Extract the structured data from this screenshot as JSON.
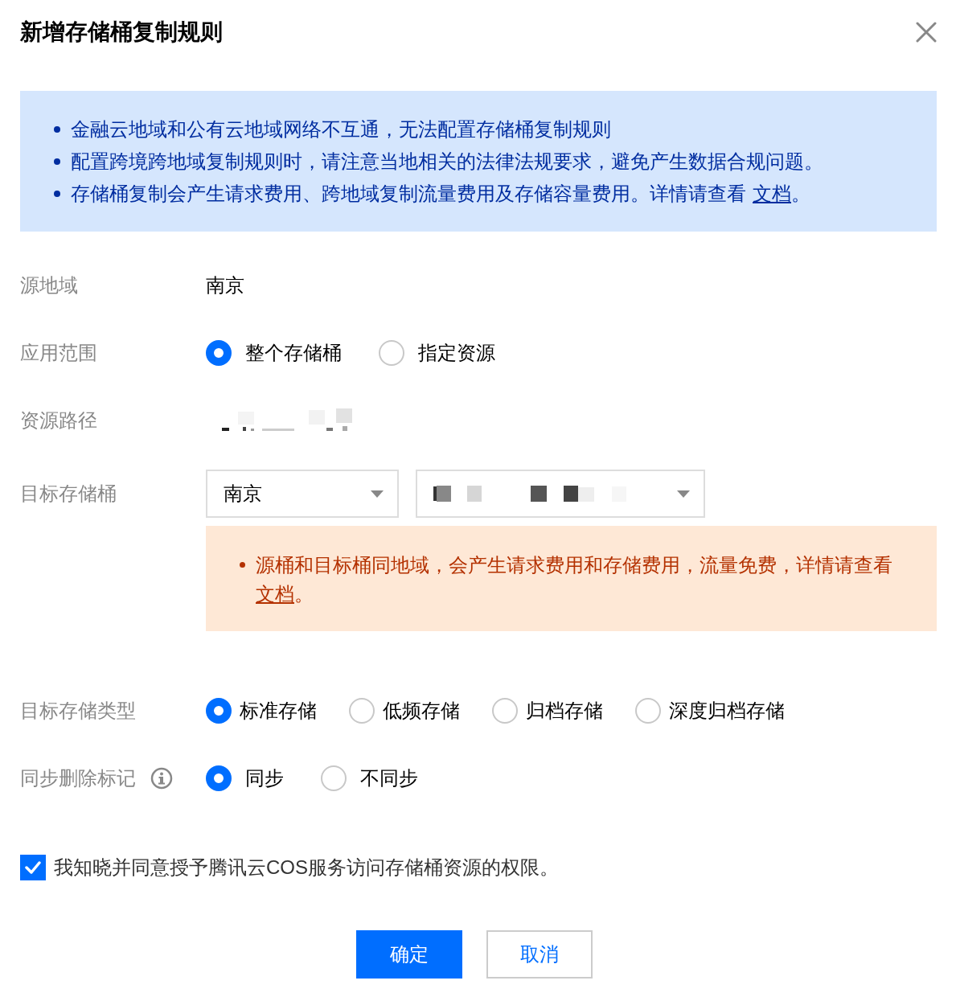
{
  "dialog": {
    "title": "新增存储桶复制规则"
  },
  "notice": {
    "items": [
      {
        "text": "金融云地域和公有云地域网络不互通，无法配置存储桶复制规则"
      },
      {
        "text": "配置跨境跨地域复制规则时，请注意当地相关的法律法规要求，避免产生数据合规问题。"
      },
      {
        "text": "存储桶复制会产生请求费用、跨地域复制流量费用及存储容量费用。详情请查看",
        "link": "文档",
        "after": "。"
      }
    ]
  },
  "fields": [
    {
      "kind": "text",
      "label": "源地域",
      "value": "南京"
    },
    {
      "kind": "radio",
      "label": "应用范围",
      "options": [
        {
          "label": "整个存储桶",
          "selected": true
        },
        {
          "label": "指定资源",
          "selected": false
        }
      ]
    },
    {
      "kind": "redacted",
      "label": "资源路径"
    },
    {
      "kind": "select",
      "label": "目标存储桶",
      "selects": [
        {
          "kind": "value",
          "value": "南京"
        },
        {
          "kind": "redacted"
        }
      ],
      "warning": {
        "text": "源桶和目标桶同地域，会产生请求费用和存储费用，流量免费，详情请查看",
        "link": "文档",
        "after": "。"
      }
    },
    {
      "kind": "radio",
      "label": "目标存储类型",
      "options": [
        {
          "label": "标准存储",
          "selected": true
        },
        {
          "label": "低频存储",
          "selected": false
        },
        {
          "label": "归档存储",
          "selected": false
        },
        {
          "label": "深度归档存储",
          "selected": false
        }
      ]
    },
    {
      "kind": "radio",
      "label": "同步删除标记",
      "info": true,
      "options": [
        {
          "label": "同步",
          "selected": true
        },
        {
          "label": "不同步",
          "selected": false
        }
      ]
    }
  ],
  "consent": {
    "label": "我知晓并同意授予腾讯云COS服务访问存储桶资源的权限。",
    "checked": true
  },
  "buttons": [
    {
      "label": "确定",
      "kind": "primary"
    },
    {
      "label": "取消",
      "kind": "secondary"
    }
  ]
}
